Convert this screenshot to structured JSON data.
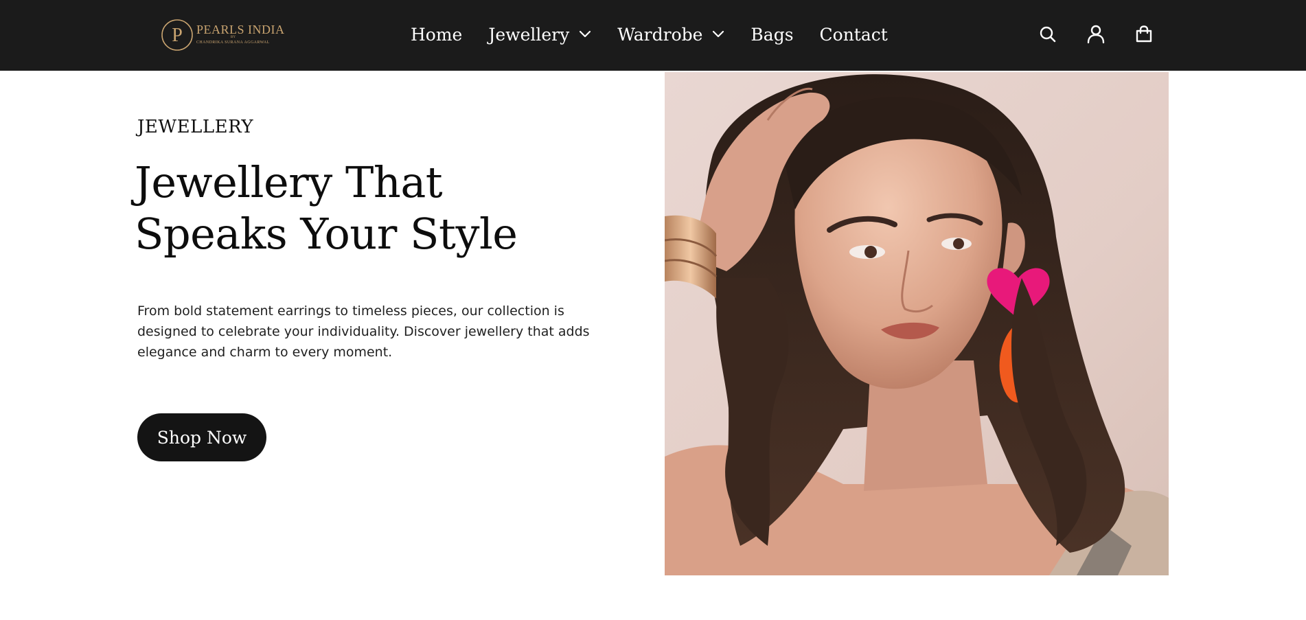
{
  "brand": {
    "name": "PEARLS INDIA",
    "by": "BY",
    "subtitle": "CHANDRIKA SURANA AGGARWAL",
    "monogram": "P",
    "gold_color": "#c9a470"
  },
  "nav": {
    "items": [
      {
        "label": "Home",
        "has_dropdown": false
      },
      {
        "label": "Jewellery",
        "has_dropdown": true
      },
      {
        "label": "Wardrobe",
        "has_dropdown": true
      },
      {
        "label": "Bags",
        "has_dropdown": false
      },
      {
        "label": "Contact",
        "has_dropdown": false
      }
    ]
  },
  "header_icons": [
    "search-icon",
    "account-icon",
    "shopping-bag-icon"
  ],
  "hero": {
    "eyebrow": "JEWELLERY",
    "headline_line1": "Jewellery That",
    "headline_line2": "Speaks Your Style",
    "description": "From bold statement earrings to timeless pieces, our collection is designed to celebrate your individuality. Discover jewellery that adds elegance and charm to every moment.",
    "cta_label": "Shop Now"
  },
  "colors": {
    "header_bg": "#1b1b1b",
    "button_bg": "#141414",
    "text": "#0d0d0d",
    "earring_pink": "#e8197a",
    "earring_orange": "#f05a1e"
  }
}
